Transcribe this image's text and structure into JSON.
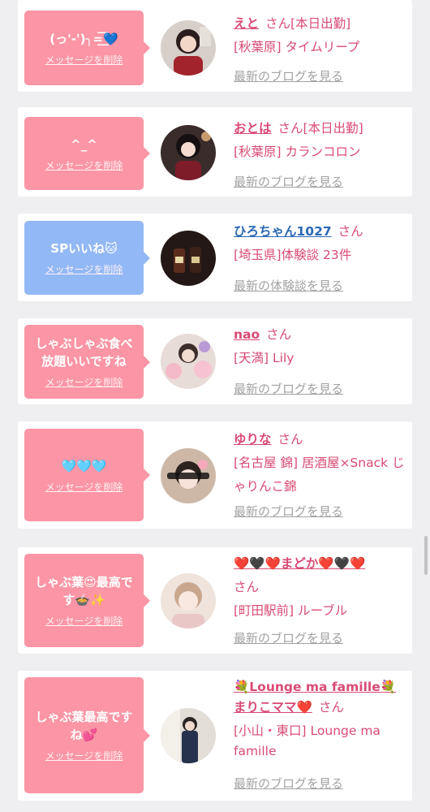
{
  "cards": [
    {
      "message": "(っ'-')╮=͟͟͞͞💙",
      "delete_label": "メッセージを削除",
      "name": "えと",
      "honorific": "さん",
      "today_badge": "[本日出勤]",
      "shop": "[秋葉原] タイムリープ",
      "link": "最新のブログを見る"
    },
    {
      "message": "^_^",
      "delete_label": "メッセージを削除",
      "name": "おとは",
      "honorific": "さん",
      "today_badge": "[本日出勤]",
      "shop": "[秋葉原] カランコロン",
      "link": "最新のブログを見る"
    },
    {
      "message": "SPいいね🐱",
      "delete_label": "メッセージを削除",
      "name": "ひろちゃん1027",
      "honorific": "さん",
      "shop": "[埼玉県]体験談 23件",
      "link": "最新の体験談を見る"
    },
    {
      "message": "しゃぶしゃぶ食べ放題いいですね",
      "delete_label": "メッセージを削除",
      "name": "nao",
      "honorific": "さん",
      "shop": "[天満] Lily",
      "link": "最新のブログを見る"
    },
    {
      "message": "🩵🩵🩵",
      "delete_label": "メッセージを削除",
      "name": "ゆりな",
      "honorific": "さん",
      "shop": "[名古屋 錦] 居酒屋×Snack じゃりんこ錦",
      "link": "最新のブログを見る"
    },
    {
      "message": "しゃぶ葉😍最高です🍲✨",
      "delete_label": "メッセージを削除",
      "name": "❤️🖤❤️まどか❤️🖤❤️",
      "honorific": "さん",
      "shop": "[町田駅前] ルーブル",
      "link": "最新のブログを見る"
    },
    {
      "message": "しゃぶ葉最高ですね💕",
      "delete_label": "メッセージを削除",
      "name": "💐Lounge ma famille💐まりこママ❤️",
      "honorific": "さん",
      "shop": "[小山・東口] Lounge ma famille",
      "link": "最新のブログを見る"
    }
  ],
  "colors": {
    "page_bg": "#efeff1",
    "bubble_pink": "#fc95a5",
    "bubble_blue": "#93b8f6",
    "name_pink": "#d94b74",
    "name_blue": "#2b69b4",
    "link_gray": "#a2a2a2"
  }
}
